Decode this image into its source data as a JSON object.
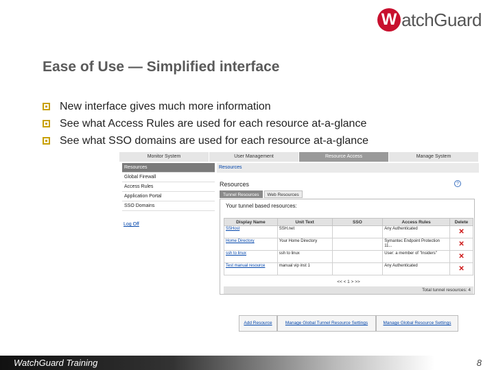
{
  "logo": {
    "mark": "W",
    "text": "atchGuard"
  },
  "slide": {
    "title": "Ease of Use — Simplified interface",
    "bullets": [
      "New interface gives much more information",
      "See what Access Rules are used for each resource at-a-glance",
      "See what SSO domains are used for each resource at-a-glance"
    ]
  },
  "app": {
    "nav_tabs": [
      "Monitor System",
      "User Management",
      "Resource Access",
      "Manage System"
    ],
    "sidebar_items": [
      "Resources",
      "Global Firewall",
      "Access Rules",
      "Application Portal",
      "SSO Domains"
    ],
    "logout": "Log Off",
    "breadcrumb": "Resources",
    "section_title": "Resources",
    "help": "?",
    "subtabs": [
      "Tunnel Resources",
      "Web Resources"
    ],
    "panel_caption": "Your tunnel based resources:",
    "table": {
      "headers": [
        "Display Name",
        "Unit Text",
        "SSO",
        "Access Rules",
        "Delete"
      ],
      "rows": [
        [
          "SSHost",
          "SSH.net",
          "",
          "Any Authenticated"
        ],
        [
          "Home Directory",
          "Your Home Directory",
          "",
          "Symantec Endpoint Protection 11..."
        ],
        [
          "ssh to linux",
          "ssh to linux",
          "",
          "User: a member of \"Insiders\""
        ],
        [
          "Test manual resource",
          "manual vip inst 1",
          "",
          "Any Authenticated"
        ]
      ]
    },
    "pager": "<< < 1 > >>",
    "total": "Total tunnel resources: 4",
    "actions": [
      "Add Resource",
      "Manage Global Tunnel Resource Settings",
      "Manage Global Resource Settings"
    ]
  },
  "footer": {
    "text": "WatchGuard Training",
    "page": "8"
  },
  "colors": {
    "brand_red": "#c8102e",
    "bullet_gold": "#c8a000",
    "link_blue": "#0044aa"
  },
  "icons": {
    "bullet": "square-bullet-icon",
    "delete": "x-icon",
    "help": "help-icon"
  }
}
